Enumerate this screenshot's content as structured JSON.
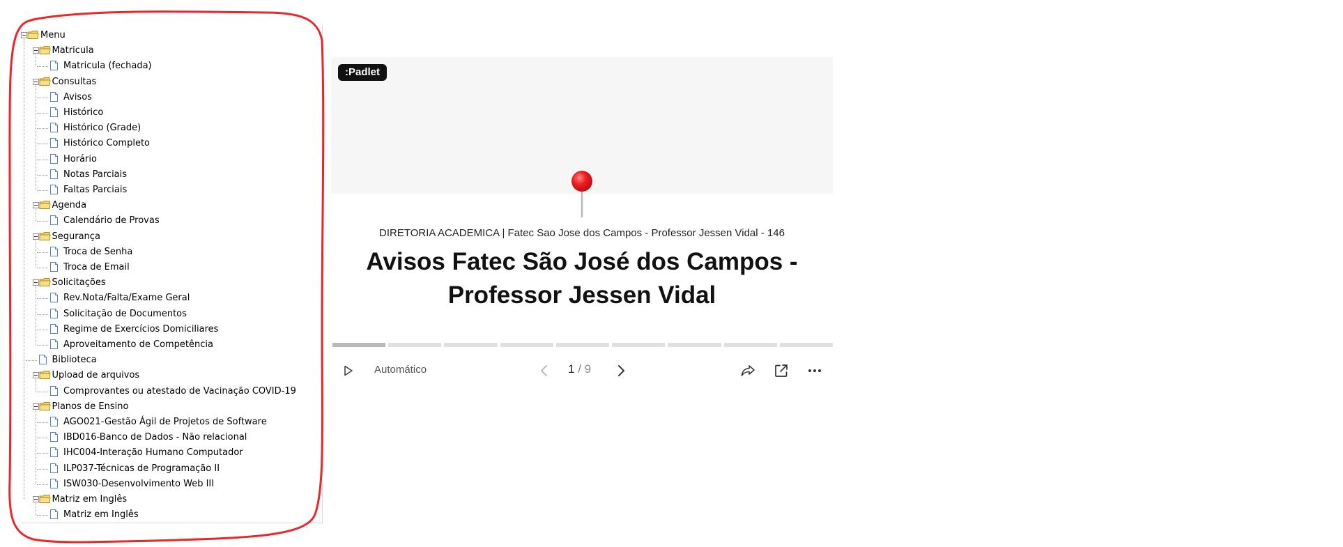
{
  "menu": {
    "items": [
      {
        "label": "Menu",
        "type": "folder",
        "level": 0,
        "expanded": true
      },
      {
        "label": "Matricula",
        "type": "folder",
        "level": 1,
        "expanded": true
      },
      {
        "label": "Matricula (fechada)",
        "type": "page",
        "level": 2
      },
      {
        "label": "Consultas",
        "type": "folder",
        "level": 1,
        "expanded": true
      },
      {
        "label": "Avisos",
        "type": "page",
        "level": 2
      },
      {
        "label": "Histórico",
        "type": "page",
        "level": 2
      },
      {
        "label": "Histórico (Grade)",
        "type": "page",
        "level": 2
      },
      {
        "label": "Histórico Completo",
        "type": "page",
        "level": 2
      },
      {
        "label": "Horário",
        "type": "page",
        "level": 2
      },
      {
        "label": "Notas Parciais",
        "type": "page",
        "level": 2
      },
      {
        "label": "Faltas Parciais",
        "type": "page",
        "level": 2
      },
      {
        "label": "Agenda",
        "type": "folder",
        "level": 1,
        "expanded": true
      },
      {
        "label": "Calendário de Provas",
        "type": "page",
        "level": 2
      },
      {
        "label": "Segurança",
        "type": "folder",
        "level": 1,
        "expanded": true
      },
      {
        "label": "Troca de Senha",
        "type": "page",
        "level": 2
      },
      {
        "label": "Troca de Email",
        "type": "page",
        "level": 2
      },
      {
        "label": "Solicitações",
        "type": "folder",
        "level": 1,
        "expanded": true
      },
      {
        "label": "Rev.Nota/Falta/Exame Geral",
        "type": "page",
        "level": 2
      },
      {
        "label": "Solicitação de Documentos",
        "type": "page",
        "level": 2
      },
      {
        "label": "Regime de Exercícios Domiciliares",
        "type": "page",
        "level": 2
      },
      {
        "label": "Aproveitamento de Competência",
        "type": "page",
        "level": 2
      },
      {
        "label": "Biblioteca",
        "type": "page",
        "level": 1
      },
      {
        "label": "Upload de arquivos",
        "type": "folder",
        "level": 1,
        "expanded": true
      },
      {
        "label": "Comprovantes ou atestado de Vacinação COVID-19",
        "type": "page",
        "level": 2
      },
      {
        "label": "Planos de Ensino",
        "type": "folder",
        "level": 1,
        "expanded": true
      },
      {
        "label": "AGO021-Gestão Ágil de Projetos de Software",
        "type": "page",
        "level": 2
      },
      {
        "label": "IBD016-Banco de Dados - Não relacional",
        "type": "page",
        "level": 2
      },
      {
        "label": "IHC004-Interação Humano Computador",
        "type": "page",
        "level": 2
      },
      {
        "label": "ILP037-Técnicas de Programação II",
        "type": "page",
        "level": 2
      },
      {
        "label": "ISW030-Desenvolvimento Web III",
        "type": "page",
        "level": 2
      },
      {
        "label": "Matriz em Inglês",
        "type": "folder",
        "level": 1,
        "expanded": true
      },
      {
        "label": "Matriz em Inglês",
        "type": "page",
        "level": 2
      }
    ]
  },
  "padlet": {
    "logo": ":Padlet",
    "subheading": "DIRETORIA ACADEMICA | Fatec Sao Jose dos Campos - Professor Jessen Vidal - 146",
    "title_line1": "Avisos Fatec São José dos Campos -",
    "title_line2": "Professor Jessen Vidal",
    "autoplay_label": "Automático",
    "page_current": "1",
    "page_separator": "/",
    "page_total": "9",
    "slide_count": 9,
    "active_slide": 1
  },
  "icons": {
    "play": "play-icon",
    "prev": "chevron-left-icon",
    "next": "chevron-right-icon",
    "share": "share-icon",
    "open": "external-link-icon",
    "more": "more-horizontal-icon",
    "pin": "map-pin-icon",
    "folder": "folder-icon",
    "page": "document-icon"
  },
  "colors": {
    "annotation_outline": "#e8262b",
    "pin_red": "#e8262b",
    "folder_yellow": "#f4d46a",
    "page_blue": "#5b7fc2",
    "header_gray": "#f6f6f6",
    "progress_active": "#b8b8b8",
    "progress_inactive": "#e0e0e0"
  }
}
